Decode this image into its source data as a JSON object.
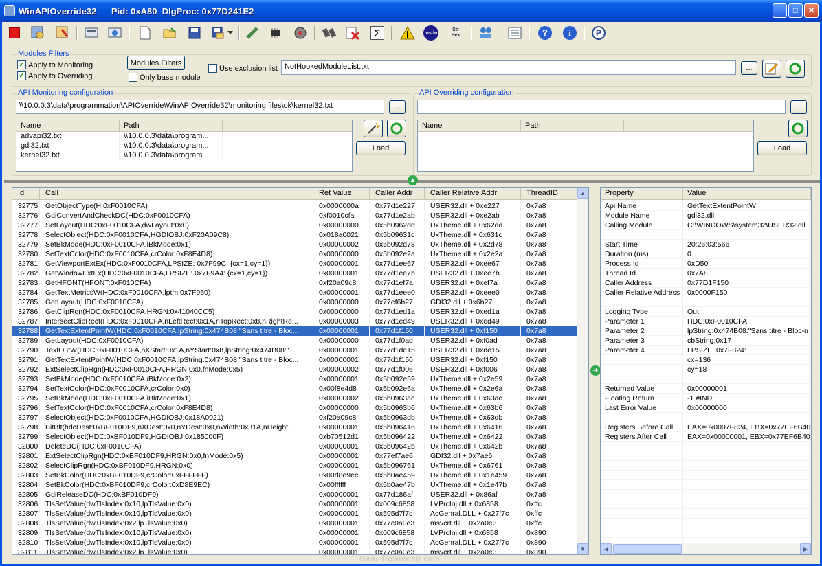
{
  "window": {
    "title": "WinAPIOverride32",
    "pid_text": "Pid: 0xA80",
    "dlgproc_text": "DlgProc: 0x77D241E2",
    "minimize": "_",
    "maximize": "□",
    "close": "✕"
  },
  "toolbar": {
    "msdn_label": "msdn",
    "strhex_label": "Str Hex",
    "sigma": "Σ"
  },
  "modules_filters": {
    "group_label": "Modules Filters",
    "apply_monitoring": "Apply to Monitoring",
    "apply_overriding": "Apply to Overriding",
    "filters_button": "Modules Filters",
    "only_base_module": "Only base module",
    "use_exclusion_list": "Use exclusion list",
    "exclusion_file": "NotHookedModuleList.txt",
    "browse": "..."
  },
  "monitoring": {
    "group_label": "API Monitoring configuration",
    "file_path": "\\\\10.0.0.3\\data\\programmation\\APIOverride\\WinAPIOverride32\\monitoring files\\ok\\kernel32.txt",
    "browse": "...",
    "columns": [
      "Name",
      "Path"
    ],
    "rows": [
      {
        "name": "advapi32.txt",
        "path": "\\\\10.0.0.3\\data\\program..."
      },
      {
        "name": "gdi32.txt",
        "path": "\\\\10.0.0.3\\data\\program..."
      },
      {
        "name": "kernel32.txt",
        "path": "\\\\10.0.0.3\\data\\program..."
      }
    ],
    "load_button": "Load"
  },
  "overriding": {
    "group_label": "API Overriding configuration",
    "file_path": "",
    "browse": "...",
    "columns": [
      "Name",
      "Path"
    ],
    "load_button": "Load"
  },
  "calls_table": {
    "columns": [
      "Id",
      "Call",
      "Ret Value",
      "Caller Addr",
      "Caller Relative Addr",
      "ThreadID"
    ],
    "rows": [
      [
        "32775",
        "GetObjectType(H:0xF0010CFA)",
        "0x0000000a",
        "0x77d1e227",
        "USER32.dll + 0xe227",
        "0x7a8"
      ],
      [
        "32776",
        "GdiConvertAndCheckDC(HDC:0xF0010CFA)",
        "0xf0010cfa",
        "0x77d1e2ab",
        "USER32.dll + 0xe2ab",
        "0x7a8"
      ],
      [
        "32777",
        "SetLayout(HDC:0xF0010CFA,dwLayout:0x0)",
        "0x00000000",
        "0x5b0962dd",
        "UxTheme.dll + 0x62dd",
        "0x7a8"
      ],
      [
        "32778",
        "SelectObject(HDC:0xF0010CFA,HGDIOBJ:0xF20A09C8)",
        "0x018a0021",
        "0x5b09631c",
        "UxTheme.dll + 0x631c",
        "0x7a8"
      ],
      [
        "32779",
        "SetBkMode(HDC:0xF0010CFA,iBkMode:0x1)",
        "0x00000002",
        "0x5b092d78",
        "UxTheme.dll + 0x2d78",
        "0x7a8"
      ],
      [
        "32780",
        "SetTextColor(HDC:0xF0010CFA,crColor:0xF8E4D8)",
        "0x00000000",
        "0x5b092e2a",
        "UxTheme.dll + 0x2e2a",
        "0x7a8"
      ],
      [
        "32781",
        "GetViewportExtEx(HDC:0xF0010CFA,LPSIZE: 0x7F99C: {cx=1,cy=1})",
        "0x00000001",
        "0x77d1ee67",
        "USER32.dll + 0xee67",
        "0x7a8"
      ],
      [
        "32782",
        "GetWindowExtEx(HDC:0xF0010CFA,LPSIZE: 0x7F9A4: {cx=1,cy=1})",
        "0x00000001",
        "0x77d1ee7b",
        "USER32.dll + 0xee7b",
        "0x7a8"
      ],
      [
        "32783",
        "GetHFONT(HFONT:0xF010CFA)",
        "0xf20a09c8",
        "0x77d1ef7a",
        "USER32.dll + 0xef7a",
        "0x7a8"
      ],
      [
        "32784",
        "GetTextMetricsW(HDC:0xF0010CFA,lptm:0x7F960)",
        "0x00000001",
        "0x77d1eee0",
        "USER32.dll + 0xeee0",
        "0x7a8"
      ],
      [
        "32785",
        "GetLayout(HDC:0xF0010CFA)",
        "0x00000000",
        "0x77ef6b27",
        "GDI32.dll + 0x6b27",
        "0x7a8"
      ],
      [
        "32786",
        "GetClipRgn(HDC:0xF0010CFA,HRGN:0x41040CC5)",
        "0x00000000",
        "0x77d1ed1a",
        "USER32.dll + 0xed1a",
        "0x7a8"
      ],
      [
        "32787",
        "IntersectClipRect(HDC:0xF0010CFA,nLeftRect:0x1A,nTopRect:0x8,nRightRe...",
        "0x00000003",
        "0x77d1ed49",
        "USER32.dll + 0xed49",
        "0x7a8"
      ],
      [
        "32788",
        "GetTextExtentPointW(HDC:0xF0010CFA,lpString:0x474B08:\"Sans titre - Bloc...",
        "0x00000001",
        "0x77d1f150",
        "USER32.dll + 0xf150",
        "0x7a8"
      ],
      [
        "32789",
        "GetLayout(HDC:0xF0010CFA)",
        "0x00000000",
        "0x77d1f0ad",
        "USER32.dll + 0xf0ad",
        "0x7a8"
      ],
      [
        "32790",
        "TextOutW(HDC:0xF0010CFA,nXStart:0x1A,nYStart:0x8,lpString:0x474B08:\"...",
        "0x00000001",
        "0x77d1de15",
        "USER32.dll + 0xde15",
        "0x7a8"
      ],
      [
        "32791",
        "GetTextExtentPointW(HDC:0xF0010CFA,lpString:0x474B08:\"Sans titre - Bloc...",
        "0x00000001",
        "0x77d1f150",
        "USER32.dll + 0xf150",
        "0x7a8"
      ],
      [
        "32792",
        "ExtSelectClipRgn(HDC:0xF0010CFA,HRGN:0x0,fnMode:0x5)",
        "0x00000002",
        "0x77d1f006",
        "USER32.dll + 0xf006",
        "0x7a8"
      ],
      [
        "32793",
        "SetBkMode(HDC:0xF0010CFA,iBkMode:0x2)",
        "0x00000001",
        "0x5b092e59",
        "UxTheme.dll + 0x2e59",
        "0x7a8"
      ],
      [
        "32794",
        "SetTextColor(HDC:0xF0010CFA,crColor:0x0)",
        "0x00f8e4d8",
        "0x5b092e6a",
        "UxTheme.dll + 0x2e6a",
        "0x7a8"
      ],
      [
        "32795",
        "SetBkMode(HDC:0xF0010CFA,iBkMode:0x1)",
        "0x00000002",
        "0x5b0963ac",
        "UxTheme.dll + 0x63ac",
        "0x7a8"
      ],
      [
        "32796",
        "SetTextColor(HDC:0xF0010CFA,crColor:0xF8E4D8)",
        "0x00000000",
        "0x5b0963b6",
        "UxTheme.dll + 0x63b6",
        "0x7a8"
      ],
      [
        "32797",
        "SelectObject(HDC:0xF0010CFA,HGDIOBJ:0x18A0021)",
        "0xf20a09c8",
        "0x5b0963db",
        "UxTheme.dll + 0x63db",
        "0x7a8"
      ],
      [
        "32798",
        "BitBlt(hdcDest:0xBF010DF9,nXDest:0x0,nYDest:0x0,nWidth:0x31A,nHeight:...",
        "0x00000001",
        "0x5b096416",
        "UxTheme.dll + 0x6416",
        "0x7a8"
      ],
      [
        "32799",
        "SelectObject(HDC:0xBF010DF9,HGDIOBJ:0x185000F)",
        "0xb70512d1",
        "0x5b096422",
        "UxTheme.dll + 0x6422",
        "0x7a8"
      ],
      [
        "32800",
        "DeleteDC(HDC:0xF0010CFA)",
        "0x00000001",
        "0x5b09642b",
        "UxTheme.dll + 0x642b",
        "0x7a8"
      ],
      [
        "32801",
        "ExtSelectClipRgn(HDC:0xBF010DF9,HRGN:0x0,fnMode:0x5)",
        "0x00000001",
        "0x77ef7ae6",
        "GDI32.dll + 0x7ae6",
        "0x7a8"
      ],
      [
        "32802",
        "SelectClipRgn(HDC:0xBF010DF9,HRGN:0x0)",
        "0x00000001",
        "0x5b096761",
        "UxTheme.dll + 0x6761",
        "0x7a8"
      ],
      [
        "32803",
        "SetBkColor(HDC:0xBF010DF9,crColor:0xFFFFFF)",
        "0x00d8e9ec",
        "0x5b0ae459",
        "UxTheme.dll + 0x1e459",
        "0x7a8"
      ],
      [
        "32804",
        "SetBkColor(HDC:0xBF010DF9,crColor:0xD8E9EC)",
        "0x00ffffff",
        "0x5b0ae47b",
        "UxTheme.dll + 0x1e47b",
        "0x7a8"
      ],
      [
        "32805",
        "GdiReleaseDC(HDC:0xBF010DF9)",
        "0x00000001",
        "0x77d186af",
        "USER32.dll + 0x86af",
        "0x7a8"
      ],
      [
        "32806",
        "TlsSetValue(dwTlsIndex:0x10,lpTlsValue:0x0)",
        "0x00000001",
        "0x009c6858",
        "LVPrcInj.dll + 0x6858",
        "0xffc"
      ],
      [
        "32807",
        "TlsSetValue(dwTlsIndex:0x10,lpTlsValue:0x0)",
        "0x00000001",
        "0x595d7f7c",
        "AcGenral.DLL + 0x27f7c",
        "0xffc"
      ],
      [
        "32808",
        "TlsSetValue(dwTlsIndex:0x2,lpTlsValue:0x0)",
        "0x00000001",
        "0x77c0a0e3",
        "msvcrt.dll + 0x2a0e3",
        "0xffc"
      ],
      [
        "32809",
        "TlsSetValue(dwTlsIndex:0x10,lpTlsValue:0x0)",
        "0x00000001",
        "0x009c6858",
        "LVPrcInj.dll + 0x6858",
        "0x890"
      ],
      [
        "32810",
        "TlsSetValue(dwTlsIndex:0x10,lpTlsValue:0x0)",
        "0x00000001",
        "0x595d7f7c",
        "AcGenral.DLL + 0x27f7c",
        "0x890"
      ],
      [
        "32811",
        "TlsSetValue(dwTlsIndex:0x2,lpTlsValue:0x0)",
        "0x00000001",
        "0x77c0a0e3",
        "msvcrt.dll + 0x2a0e3",
        "0x890"
      ]
    ],
    "selected_id": "32788"
  },
  "properties": {
    "columns": [
      "Property",
      "Value"
    ],
    "rows": [
      [
        "Api Name",
        "GetTextExtentPointW"
      ],
      [
        "Module Name",
        "gdi32.dll"
      ],
      [
        "Calling Module",
        "C:\\WINDOWS\\system32\\USER32.dll"
      ],
      [
        "",
        ""
      ],
      [
        "Start Time",
        "20:26:03:566"
      ],
      [
        "Duration (ms)",
        "0"
      ],
      [
        "Process Id",
        "0xD50"
      ],
      [
        "Thread Id",
        "0x7A8"
      ],
      [
        "Caller Address",
        "0x77D1F150"
      ],
      [
        "Caller Relative Address",
        "0x0000F150"
      ],
      [
        "",
        ""
      ],
      [
        "Logging Type",
        "Out"
      ],
      [
        "Parameter 1",
        "HDC:0xF0010CFA"
      ],
      [
        "Parameter 2",
        "lpString:0x474B08:\"Sans titre - Bloc-n"
      ],
      [
        "Parameter 3",
        "cbString:0x17"
      ],
      [
        "Parameter 4",
        "LPSIZE: 0x7F824:"
      ],
      [
        "",
        "cx=136"
      ],
      [
        "",
        "cy=18"
      ],
      [
        "",
        ""
      ],
      [
        "Returned Value",
        "0x00000001"
      ],
      [
        "Floating Return",
        "-1.#IND"
      ],
      [
        "Last Error Value",
        "0x00000000"
      ],
      [
        "",
        ""
      ],
      [
        "Registers Before Call",
        "EAX=0x0007F824, EBX=0x77EF6B40"
      ],
      [
        "Registers After Call",
        "EAX=0x00000001, EBX=0x77EF6B40"
      ],
      [
        "",
        ""
      ],
      [
        "",
        ""
      ],
      [
        "",
        ""
      ],
      [
        "",
        ""
      ],
      [
        "",
        ""
      ],
      [
        "",
        ""
      ],
      [
        "",
        ""
      ],
      [
        "",
        ""
      ],
      [
        "",
        ""
      ],
      [
        "",
        ""
      ],
      [
        "",
        ""
      ],
      [
        "",
        ""
      ]
    ]
  },
  "watermark": "Gear Download.com"
}
